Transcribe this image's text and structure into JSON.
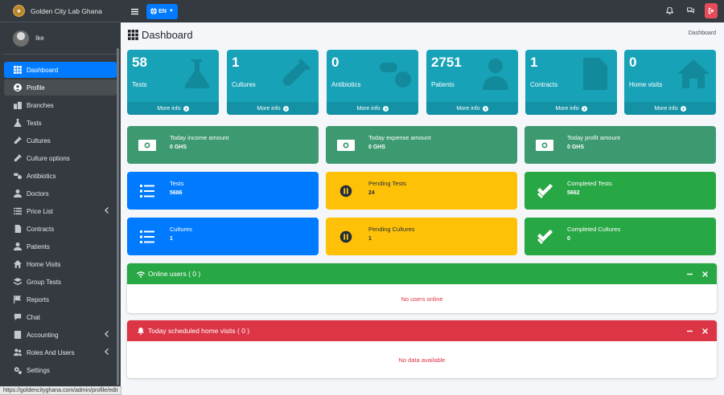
{
  "brand": {
    "name": "Golden City Lab Ghana"
  },
  "user": {
    "name": "Ike"
  },
  "sidebar": {
    "items": [
      {
        "label": "Dashboard"
      },
      {
        "label": "Profile"
      },
      {
        "label": "Branches"
      },
      {
        "label": "Tests"
      },
      {
        "label": "Cultures"
      },
      {
        "label": "Culture options"
      },
      {
        "label": "Antibiotics"
      },
      {
        "label": "Doctors"
      },
      {
        "label": "Price List"
      },
      {
        "label": "Contracts"
      },
      {
        "label": "Patients"
      },
      {
        "label": "Home Visits"
      },
      {
        "label": "Group Tests"
      },
      {
        "label": "Reports"
      },
      {
        "label": "Chat"
      },
      {
        "label": "Accounting"
      },
      {
        "label": "Roles And Users"
      },
      {
        "label": "Settings"
      }
    ]
  },
  "navbar": {
    "language": "EN"
  },
  "page": {
    "title": "Dashboard",
    "breadcrumb": "Dashboard"
  },
  "stats": [
    {
      "count": "58",
      "label": "Tests",
      "more": "More info"
    },
    {
      "count": "1",
      "label": "Cultures",
      "more": "More info"
    },
    {
      "count": "0",
      "label": "Antibiotics",
      "more": "More info"
    },
    {
      "count": "2751",
      "label": "Patients",
      "more": "More info"
    },
    {
      "count": "1",
      "label": "Contracts",
      "more": "More info"
    },
    {
      "count": "0",
      "label": "Home visits",
      "more": "More info"
    }
  ],
  "finance": [
    {
      "title": "Today income amount",
      "value": "0 GHS"
    },
    {
      "title": "Today expense amount",
      "value": "0 GHS"
    },
    {
      "title": "Today profit amount",
      "value": "0 GHS"
    }
  ],
  "tests_row": [
    {
      "title": "Tests",
      "value": "5686"
    },
    {
      "title": "Pending Tests",
      "value": "24"
    },
    {
      "title": "Completed Tests",
      "value": "5662"
    }
  ],
  "cultures_row": [
    {
      "title": "Cultures",
      "value": "1"
    },
    {
      "title": "Pending Cultures",
      "value": "1"
    },
    {
      "title": "Completed Cultures",
      "value": "0"
    }
  ],
  "online_users": {
    "title": "Online users ( 0 )",
    "empty": "No users online"
  },
  "home_visits": {
    "title": "Today scheduled home visits ( 0 )",
    "empty": "No data available"
  },
  "status_bar": {
    "url": "https://goldencityghana.com/admin/profile/edit"
  },
  "colors": {
    "sidebar_bg": "#343a40",
    "primary": "#007bff",
    "info": "#17a2b8",
    "olive": "#3d9970",
    "warning": "#ffc107",
    "success": "#28a745",
    "danger": "#dc3545"
  }
}
